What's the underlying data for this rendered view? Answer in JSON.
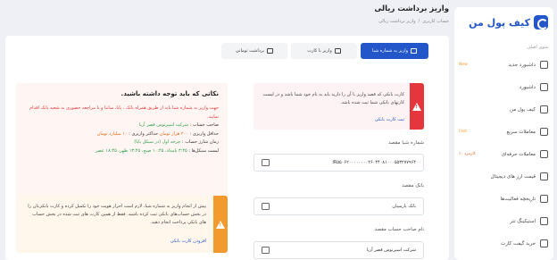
{
  "sidebar": {
    "logo_text": "کیف پول من",
    "menu_heading": "منوی اصلی",
    "items": [
      {
        "label": "داشبورد جدید",
        "badge": "New",
        "icon": "dashboard-new-icon"
      },
      {
        "label": "داشبورد",
        "badge": "",
        "icon": "dashboard-icon"
      },
      {
        "label": "کیف پول من",
        "badge": "",
        "icon": "wallet-icon"
      },
      {
        "label": "معاملات سریع",
        "badge": "Fast",
        "icon": "fast-trade-icon"
      },
      {
        "label": "معاملات حرفه‌ای",
        "badge": "کارمزد ۰٪",
        "icon": "pro-trade-icon"
      },
      {
        "label": "قیمت ارز های دیجیتال",
        "badge": "",
        "icon": "prices-icon"
      },
      {
        "label": "تاریخچه فعالیت‌ها",
        "badge": "",
        "icon": "history-icon"
      },
      {
        "label": "استیکینگ تتر",
        "badge": "",
        "icon": "staking-icon"
      },
      {
        "label": "خرید گیفت کارت",
        "badge": "",
        "icon": "gift-card-icon"
      }
    ]
  },
  "header": {
    "title": "واریز برداشت ریالی",
    "breadcrumb": [
      "حساب کاربری",
      "/",
      "واریز برداشت ریالی"
    ]
  },
  "tabs": [
    {
      "label": "واریز به شماره شبا",
      "active": true
    },
    {
      "label": "واریز با کارت",
      "active": false
    },
    {
      "label": "برداشت تومانی",
      "active": false
    }
  ],
  "alert": {
    "text": "کارت بانکی که قصد واریز با آن را دارید باید به نام خود شما باشد و در لیست کارتهای بانکی شما ثبت شده باشد.",
    "link": "ثبت کارت بانکی"
  },
  "form": {
    "sheba_label": "شماره شبا مقصد",
    "sheba_value": "IR۵۵۰۶۲۰۰۰۰۰۰۰۰۲۶۰۴۴۰۸۱۰۰۰۵۵۳۲۷۷۹۶۴",
    "bank_label": "بانک مقصد",
    "bank_value": "بانک پارسیان",
    "owner_label": "نام صاحب حساب مقصد",
    "owner_value": "شرکت اسپرتوس قصر آریا"
  },
  "notice": {
    "title": "نکاتی که باید توجه داشته باشید.",
    "red_text": "جهت واریز به شماره شبا باید از طریق همراه بانک ، پایا، ساتنا و یا مراجعه حضوری به شعبه بانک اقدام نمایید.",
    "owner_prefix": "صاحب حساب :",
    "owner_value": "شرکت اسپرتوس قصر آریا",
    "min_prefix": "حداقل واریزی :",
    "min_value": "۲۰۰ هزار تومان",
    "max_prefix": "حداکثر واریزی :",
    "max_value": "۱۰ میلیارد تومان",
    "time_prefix": "زمان شارژ حساب :",
    "time_value": "چرخه اول (در سیکل پایا)",
    "cycles_prefix": "لیست سیکل‌ها :",
    "cycles_value": "۳:۴۵ بامداد، ۱۰:۴۵ صبح، ۱۳:۴۵ ظهر، ۱۸:۴۵ عصر"
  },
  "warning": {
    "text": "پیش از انجام واریز به شماره شبا، لازم است احراز هویت خود را تکمیل کرده و کارت بانکی‌تان را در بخش حساب‌های بانکی ثبت کرده باشید. فقط از همین کارت های ثبت شده در بخش حساب های بانکی پرداخت انجام دهید.",
    "link": "افزودن کارت بانکی"
  }
}
